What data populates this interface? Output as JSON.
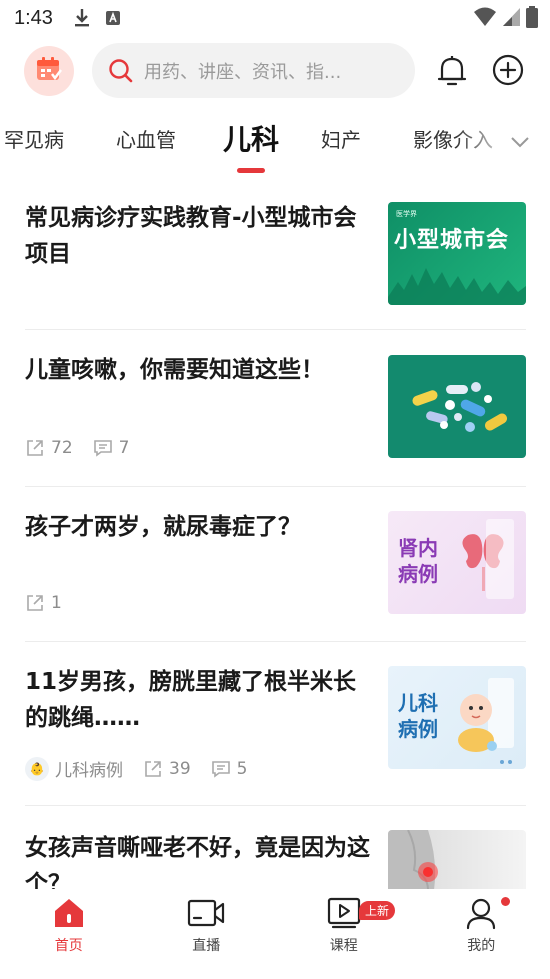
{
  "status_bar": {
    "time": "1:43"
  },
  "search": {
    "placeholder": "用药、讲座、资讯、指..."
  },
  "tabs": [
    {
      "label": "罕见病"
    },
    {
      "label": "心血管"
    },
    {
      "label": "儿科"
    },
    {
      "label": "妇产"
    },
    {
      "label": "影像介入"
    }
  ],
  "articles": [
    {
      "title": "常见病诊疗实践教育-小型城市会项目",
      "thumb_text": "小型城市会",
      "thumb_tag": "医学界"
    },
    {
      "title": "儿童咳嗽，你需要知道这些！",
      "shares": "72",
      "comments": "7"
    },
    {
      "title": "孩子才两岁，就尿毒症了？",
      "shares": "1",
      "thumb_text": "肾内病例"
    },
    {
      "title": "11岁男孩，膀胱里藏了根半米长的跳绳……",
      "author": "儿科病例",
      "shares": "39",
      "comments": "5",
      "thumb_text": "儿科病例"
    },
    {
      "title": "女孩声音嘶哑老不好，竟是因为这个？"
    }
  ],
  "bottom_nav": [
    {
      "label": "首页"
    },
    {
      "label": "直播"
    },
    {
      "label": "课程",
      "badge": "上新"
    },
    {
      "label": "我的"
    }
  ],
  "colors": {
    "accent": "#e5383b",
    "muted": "#8c8c8c"
  }
}
